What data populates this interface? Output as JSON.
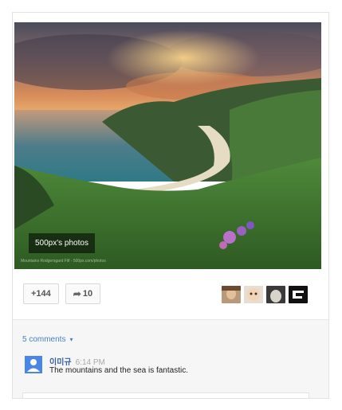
{
  "post": {
    "photo_source_label": "500px's photos",
    "photo_fineprint": "Mountains Rodgersgard Flif - 500px.com/photos",
    "plus_count": "+144",
    "share_count": "10",
    "commenter_avatars": [
      "avatar-woman",
      "avatar-baby",
      "avatar-bird",
      "avatar-logo"
    ]
  },
  "comments": {
    "count_label": "5 comments",
    "items": [
      {
        "author": "이미규",
        "time": "6:14 PM",
        "text": "The mountains and the sea is fantastic."
      }
    ]
  },
  "colors": {
    "link": "#4a7fc8",
    "avatar_default": "#4a86e8",
    "comment_bg": "#f6f6f6"
  }
}
